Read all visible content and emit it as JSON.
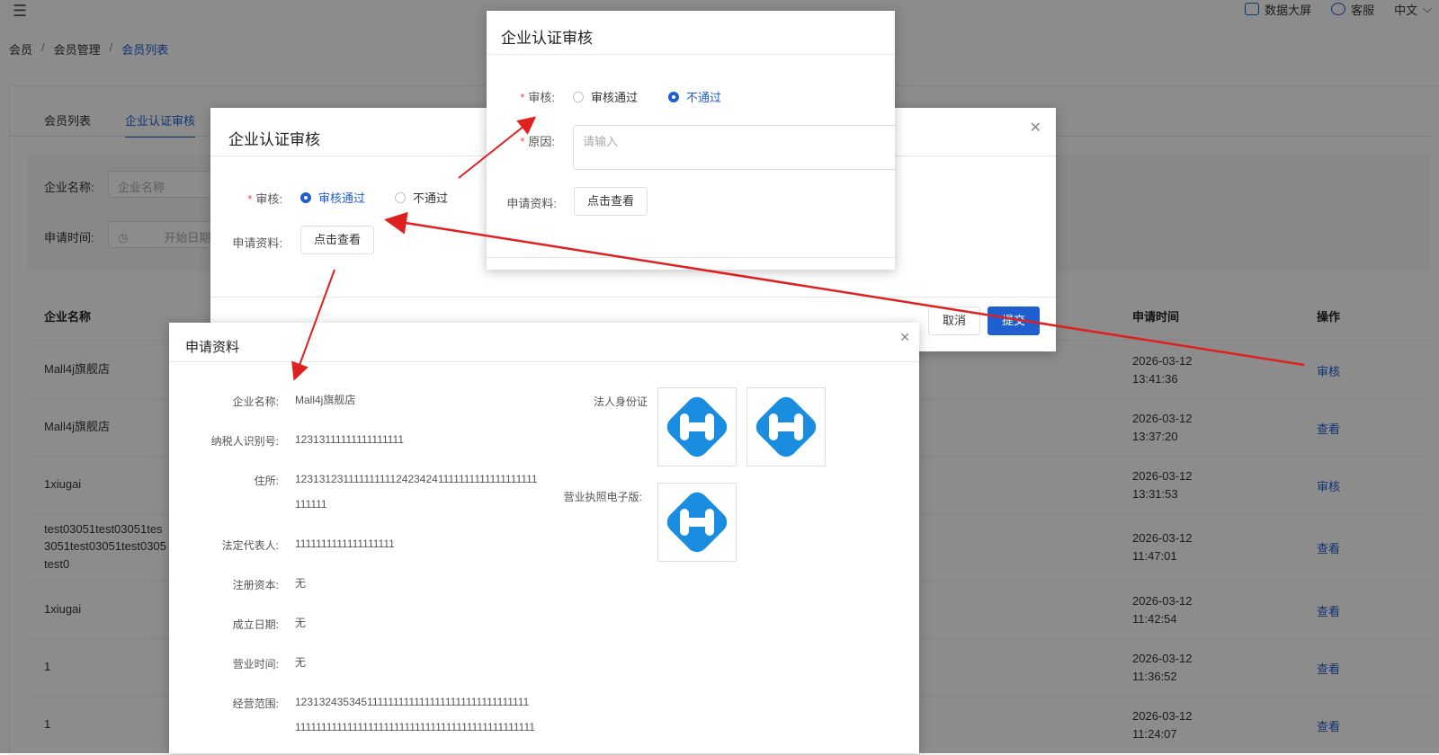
{
  "header": {
    "data_screen": "数据大屏",
    "service": "客服",
    "language": "中文"
  },
  "breadcrumb": [
    "会员",
    "会员管理",
    "会员列表"
  ],
  "tabs": [
    "会员列表",
    "企业认证审核"
  ],
  "search": {
    "company_label": "企业名称:",
    "company_placeholder": "企业名称",
    "time_label": "申请时间:",
    "start_placeholder": "开始日期"
  },
  "table": {
    "headers": [
      "企业名称",
      "申请时间",
      "操作"
    ],
    "rows": [
      {
        "company": "Mall4j旗舰店",
        "date": "2026-03-12",
        "time": "13:41:36",
        "op": "审核"
      },
      {
        "company": "Mall4j旗舰店",
        "date": "2026-03-12",
        "time": "13:37:20",
        "op": "查看"
      },
      {
        "company": "1xiugai",
        "date": "2026-03-12",
        "time": "13:31:53",
        "op": "审核"
      },
      {
        "company": "test03051test03051test03051test03051test03051test0",
        "line1": "test03051test03051tes",
        "line2": "3051test03051test0305",
        "line3": "test0",
        "date": "2026-03-12",
        "time": "11:47:01",
        "op": "查看"
      },
      {
        "company": "1xiugai",
        "date": "2026-03-12",
        "time": "11:42:54",
        "op": "查看"
      },
      {
        "company": "1",
        "date": "2026-03-12",
        "time": "11:36:52",
        "op": "查看"
      },
      {
        "company": "1",
        "date": "2026-03-12",
        "time": "11:24:07",
        "op": "查看"
      }
    ]
  },
  "dialog_audit": {
    "title": "企业认证审核",
    "audit_label": "审核:",
    "pass": "审核通过",
    "fail": "不通过",
    "materials_label": "申请资料:",
    "view_button": "点击查看",
    "cancel": "取消",
    "submit": "提交"
  },
  "dialog_reject": {
    "title": "企业认证审核",
    "audit_label": "审核:",
    "pass": "审核通过",
    "fail": "不通过",
    "reason_label": "原因:",
    "reason_placeholder": "请输入",
    "materials_label": "申请资料:",
    "view_button": "点击查看"
  },
  "dialog_materials": {
    "title": "申请资料",
    "fields": [
      {
        "label": "企业名称:",
        "value": "Mall4j旗舰店"
      },
      {
        "label": "纳税人识别号:",
        "value": "12313111111111111111"
      },
      {
        "label": "住所:",
        "value": "12313123111111111124234241111111111111111111",
        "value2": "111111"
      },
      {
        "label": "法定代表人:",
        "value": "1111111111111111111"
      },
      {
        "label": "注册资本:",
        "value": "无"
      },
      {
        "label": "成立日期:",
        "value": "无"
      },
      {
        "label": "营业时间:",
        "value": "无"
      },
      {
        "label": "经营范围:",
        "value": "1231324353451111111111111111111111111111111",
        "value2": "1111111111111111111111111111111111111111111111"
      }
    ],
    "id_card_label": "法人身份证",
    "license_label": "营业执照电子版:"
  },
  "colors": {
    "primary": "#1f5fd0",
    "arrow": "#e0201e"
  }
}
